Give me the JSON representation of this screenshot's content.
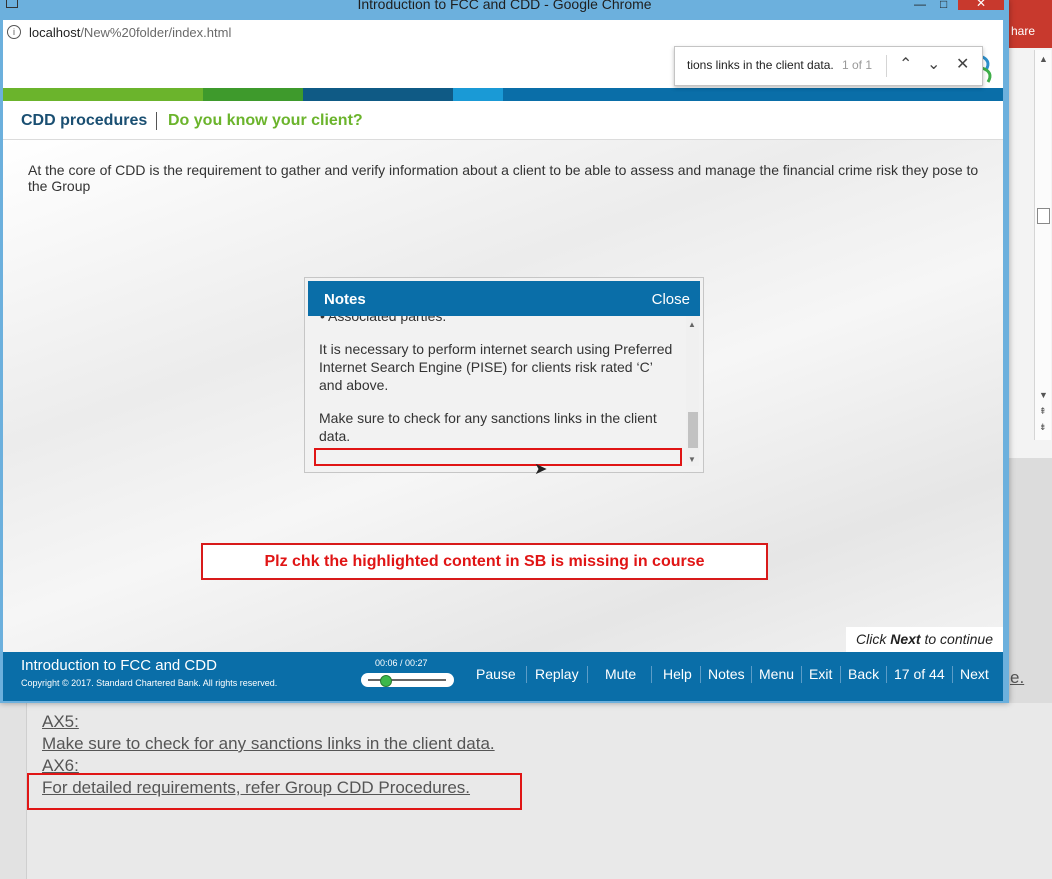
{
  "window": {
    "title": "Introduction to FCC and CDD - Google Chrome",
    "url_host": "localhost",
    "url_path": "/New%20folder/index.html"
  },
  "findbar": {
    "query": "tions links in the client data.",
    "count": "1 of 1"
  },
  "header": {
    "section": "CDD procedures",
    "subsection": "Do you know your client?"
  },
  "intro": "At the core of CDD is the requirement to gather and verify information about a client to be able to assess and manage the financial crime risk they pose to the Group",
  "notes": {
    "title": "Notes",
    "close": "Close",
    "bullet_partial": "Associated parties.",
    "para1": "It is necessary to perform internet search using Preferred Internet Search Engine (PISE) for clients risk rated ‘C’ and above.",
    "para2": "Make sure to check for any sanctions links in the client data."
  },
  "message": "Plz chk the highlighted content in SB is missing in course",
  "click_next": {
    "pre": "Click",
    "bold": "Next",
    "post": "to continue"
  },
  "footer": {
    "course_title": "Introduction to FCC and CDD",
    "copyright": "Copyright © 2017. Standard Chartered Bank. All rights reserved.",
    "time": "00:06 / 00:27",
    "progress": 0.22,
    "pause": "Pause",
    "replay": "Replay",
    "mute": "Mute",
    "help": "Help",
    "notes": "Notes",
    "menu": "Menu",
    "exit": "Exit",
    "back": "Back",
    "page": "17 of 44",
    "next": "Next"
  },
  "background_doc": {
    "share_label": "hare",
    "tail_link": "e.",
    "line1": "AX5:",
    "line2": "Make sure to check for any sanctions links in the client data.",
    "line3": "AX6:",
    "line4": "For detailed requirements, refer Group CDD Procedures."
  },
  "colors": {
    "brand_blue": "#0a6ea8",
    "brand_green": "#6bb42c",
    "highlight_red": "#e01515"
  }
}
